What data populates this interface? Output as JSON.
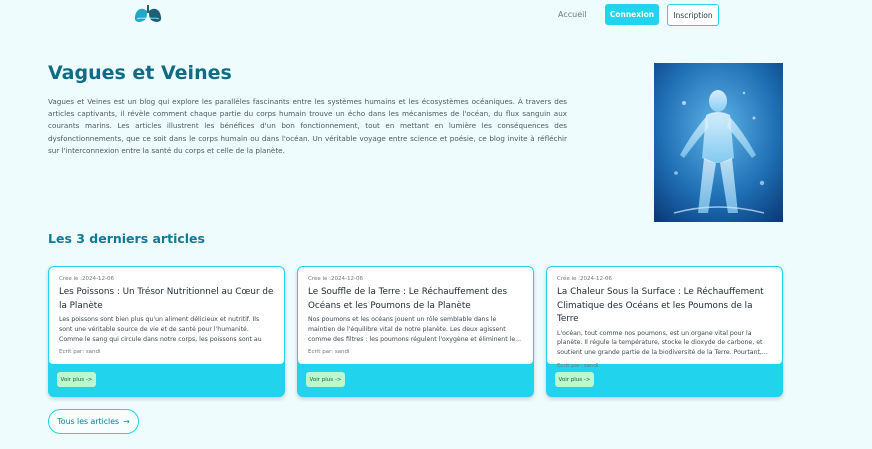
{
  "nav": {
    "home_label": "Accueil",
    "login_label": "Connexion",
    "signup_label": "Inscription"
  },
  "hero": {
    "title": "Vagues et Veines",
    "description": "Vagues et Veines est un blog qui explore les parallèles fascinants entre les systèmes humains et les écosystèmes océaniques. À travers des articles captivants, il révèle comment chaque partie du corps humain trouve un écho dans les mécanismes de l'océan, du flux sanguin aux courants marins. Les articles illustrent les bénéfices d'un bon fonctionnement, tout en mettant en lumière les conséquences des dysfonctionnements, que ce soit dans le corps humain ou dans l'océan. Un véritable voyage entre science et poésie, ce blog invite à réfléchir sur l'interconnexion entre la santé du corps et celle de la planète."
  },
  "articles_section": {
    "title": "Les 3 derniers articles",
    "all_label": "Tous les articles",
    "all_arrow": "→"
  },
  "articles": [
    {
      "date": "Crée le :2024-12-06",
      "title": "Les Poissons : Un Trésor Nutritionnel au Cœur de la Planète",
      "excerpt": "Les poissons sont bien plus qu'un aliment délicieux et nutritif. Ils sont une véritable source de vie et de santé pour l'humanité. Comme le sang qui circule dans notre corps, les poissons sont au centre de...",
      "author": "Ecrit par: sandi",
      "button": "Voir plus ->"
    },
    {
      "date": "Crée le :2024-12-06",
      "title": "Le Souffle de la Terre : Le Réchauffement des Océans et les Poumons de la Planète",
      "excerpt": "Nos poumons et les océans jouent un rôle semblable dans le maintien de l'équilibre vital de notre planète. Les deux agissent comme des filtres : les poumons régulent l'oxygène et éliminent le...",
      "author": "Ecrit par: sandi",
      "button": "Voir plus ->"
    },
    {
      "date": "Crée le :2024-12-06",
      "title": "La Chaleur Sous la Surface : Le Réchauffement Climatique des Océans et les Poumons de la Terre",
      "excerpt": "L'océan, tout comme nos poumons, est un organe vital pour la planète. Il régule la température, stocke le dioxyde de carbone, et soutient une grande partie de la biodiversité de la Terre. Pourtant,...",
      "author": "Ecrit par: sandi",
      "button": "Voir plus ->"
    }
  ],
  "colors": {
    "accent": "#22d3ee",
    "title": "#0e6c86",
    "background": "#effcfd",
    "button_green": "#bbf7d0"
  },
  "icons": {
    "logo": "lungs-icon",
    "arrow": "arrow-right-icon"
  }
}
